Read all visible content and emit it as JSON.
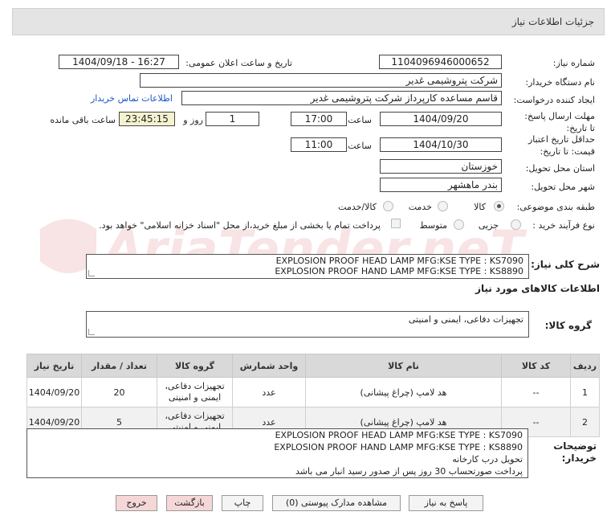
{
  "header": {
    "title": "جزئیات اطلاعات نیاز"
  },
  "fields": {
    "need_number_label": "شماره نیاز:",
    "need_number": "1104096946000652",
    "announce_label": "تاریخ و ساعت اعلان عمومی:",
    "announce_value": "1404/09/18 - 16:27",
    "buyer_org_label": "نام دستگاه خریدار:",
    "buyer_org": "شرکت پتروشیمی غدیر",
    "creator_label": "ایجاد کننده درخواست:",
    "creator": "قاسم مساعده کارپرداز شرکت پتروشیمی غدیر",
    "contact_link": "اطلاعات تماس خریدار",
    "deadline_label": "مهلت ارسال پاسخ: تا تاریخ:",
    "deadline_date": "1404/09/20",
    "time_word": "ساعت",
    "deadline_time": "17:00",
    "days_value": "1",
    "days_word": "روز و",
    "remaining_time": "23:45:15",
    "remaining_label": "ساعت باقی مانده",
    "validity_label": "حداقل تاریخ اعتبار قیمت: تا تاریخ:",
    "validity_date": "1404/10/30",
    "validity_time": "11:00",
    "province_label": "استان محل تحویل:",
    "province": "خوزستان",
    "city_label": "شهر محل تحویل:",
    "city": "بندر ماهشهر",
    "category_label": "طبقه بندی موضوعی:",
    "category_options": [
      "کالا",
      "خدمت",
      "کالا/خدمت"
    ],
    "category_selected": "کالا",
    "process_label": "نوع فرآیند خرید :",
    "process_options": [
      "جزیی",
      "متوسط"
    ],
    "process_note": "پرداخت تمام یا بخشی از مبلغ خرید،از محل \"اسناد خزانه اسلامی\" خواهد بود."
  },
  "summary": {
    "label": "شرح کلی نیاز:",
    "lines": [
      "EXPLOSION PROOF  HEAD LAMP MFG:KSE TYPE : KS7090",
      "EXPLOSION PROOF  HAND LAMP  MFG:KSE TYPE : KS8890"
    ]
  },
  "goods_info_title": "اطلاعات کالاهای مورد نیاز",
  "goods_group": {
    "label": "گروه کالا:",
    "value": "تجهیزات دفاعی، ایمنی و امنیتی"
  },
  "table": {
    "headers": [
      "ردیف",
      "کد کالا",
      "نام کالا",
      "واحد شمارش",
      "گروه کالا",
      "تعداد / مقدار",
      "تاریخ نیاز"
    ],
    "rows": [
      [
        "1",
        "--",
        "هد لامپ (چراغ پیشانی)",
        "عدد",
        "تجهیزات دفاعی، ایمنی و امنیتی",
        "20",
        "1404/09/20"
      ],
      [
        "2",
        "--",
        "هد لامپ (چراغ پیشانی)",
        "عدد",
        "تجهیزات دفاعی، ایمنی و امنیتی",
        "5",
        "1404/09/20"
      ]
    ]
  },
  "buyer_notes": {
    "label": "توضیحات خریدار:",
    "lines": [
      "EXPLOSION PROOF  HEAD LAMP MFG:KSE TYPE : KS7090",
      "EXPLOSION PROOF  HAND LAMP  MFG:KSE TYPE : KS8890",
      "تحویل درب کارخانه",
      "پرداخت صورتحساب 30 روز پس از صدور رسید انبار می باشد"
    ]
  },
  "buttons": {
    "reply": "پاسخ به نیاز",
    "docs": "مشاهده مدارک پیوستی (0)",
    "print": "چاپ",
    "back": "بازگشت",
    "exit": "خروج"
  },
  "watermark": "AriaTender.neT",
  "colors": {
    "link": "#1a56c8",
    "remaining_bg": "#f5f2cf",
    "header_bg": "#e4e4e4",
    "pink_button": "#f6d7d7"
  }
}
